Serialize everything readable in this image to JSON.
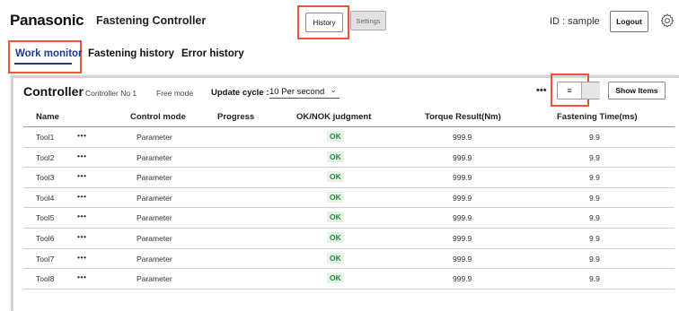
{
  "header": {
    "brand": "Panasonic",
    "app_title": "Fastening Controller",
    "history_label": "History",
    "settings_label": "Settings",
    "user_id": "ID : sample",
    "logout_label": "Logout"
  },
  "tabs": [
    {
      "label": "Work monitor",
      "active": true
    },
    {
      "label": "Fastening history",
      "active": false
    },
    {
      "label": "Error history",
      "active": false
    }
  ],
  "controller": {
    "title": "Controller",
    "number": "Controller No 1",
    "mode": "Free mode",
    "update_label": "Update cycle :",
    "update_value": "10 Per second",
    "more": "•••",
    "view_icon": "≡",
    "show_items_label": "Show Items"
  },
  "table": {
    "columns": [
      "Name",
      "Control mode",
      "Progress",
      "OK/NOK judgment",
      "Torque Result(Nm)",
      "Fastening Time(ms)"
    ],
    "rows": [
      {
        "name": "Tool1",
        "more": "•••",
        "mode": "Parameter",
        "judgment": "OK",
        "torque": "999.9",
        "time": "9.9"
      },
      {
        "name": "Tool2",
        "more": "•••",
        "mode": "Parameter",
        "judgment": "OK",
        "torque": "999.9",
        "time": "9.9"
      },
      {
        "name": "Tool3",
        "more": "•••",
        "mode": "Parameter",
        "judgment": "OK",
        "torque": "999.9",
        "time": "9.9"
      },
      {
        "name": "Tool4",
        "more": "•••",
        "mode": "Parameter",
        "judgment": "OK",
        "torque": "999.9",
        "time": "9.9"
      },
      {
        "name": "Tool5",
        "more": "•••",
        "mode": "Parameter",
        "judgment": "OK",
        "torque": "999.9",
        "time": "9.9"
      },
      {
        "name": "Tool6",
        "more": "•••",
        "mode": "Parameter",
        "judgment": "OK",
        "torque": "999.9",
        "time": "9.9"
      },
      {
        "name": "Tool7",
        "more": "•••",
        "mode": "Parameter",
        "judgment": "OK",
        "torque": "999.9",
        "time": "9.9"
      },
      {
        "name": "Tool8",
        "more": "•••",
        "mode": "Parameter",
        "judgment": "OK",
        "torque": "999.9",
        "time": "9.9"
      }
    ]
  },
  "colors": {
    "accent": "#1a3c8c",
    "highlight": "#e8553a",
    "ok_text": "#1f8b3a",
    "ok_bg": "#e6f3e6"
  }
}
